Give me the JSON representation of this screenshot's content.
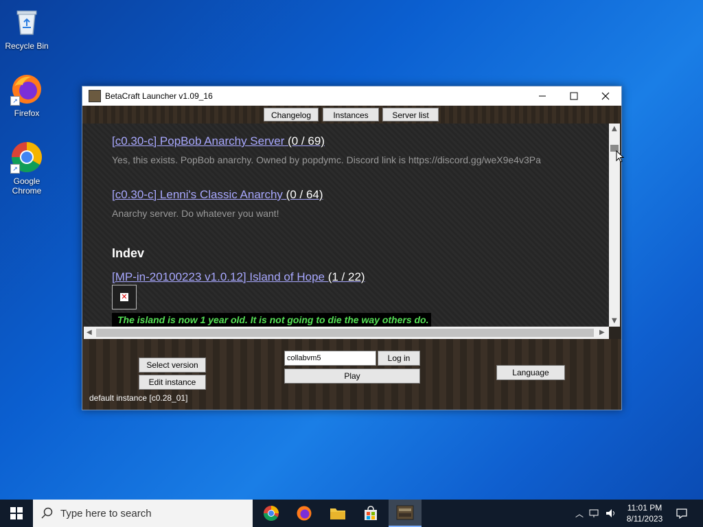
{
  "desktop": {
    "icons": [
      {
        "label": "Recycle Bin"
      },
      {
        "label": "Firefox"
      },
      {
        "label": "Google Chrome"
      }
    ]
  },
  "window": {
    "title": "BetaCraft Launcher v1.09_16",
    "tabs": [
      "Changelog",
      "Instances",
      "Server list"
    ],
    "servers": [
      {
        "name": "[c0.30-c] PopBob Anarchy Server",
        "count": "(0 / 69)",
        "description": "Yes, this exists. PopBob anarchy. Owned by popdymc. Discord link is https://discord.gg/weX9e4v3Pa"
      },
      {
        "name": "[c0.30-c] Lenni's Classic Anarchy",
        "count": "(0 / 64)",
        "description": "Anarchy server. Do whatever you want!"
      }
    ],
    "section": "Indev",
    "indev_server": {
      "name": "[MP-in-20100223 v1.0.12] Island of Hope",
      "count": "(1 / 22)",
      "motd": "The island is now 1 year old. It is not going to die the way others do."
    },
    "bottom": {
      "select_version": "Select version",
      "edit_instance": "Edit instance",
      "username_value": "collabvm5",
      "login": "Log in",
      "play": "Play",
      "language": "Language",
      "instance_label": "default instance [c0.28_01]"
    }
  },
  "taskbar": {
    "search_placeholder": "Type here to search",
    "time": "11:01 PM",
    "date": "8/11/2023"
  },
  "colors": {
    "link": "#a8a8ff",
    "motd_green": "#55e055",
    "desktop_blue": "#0b5fd0"
  }
}
